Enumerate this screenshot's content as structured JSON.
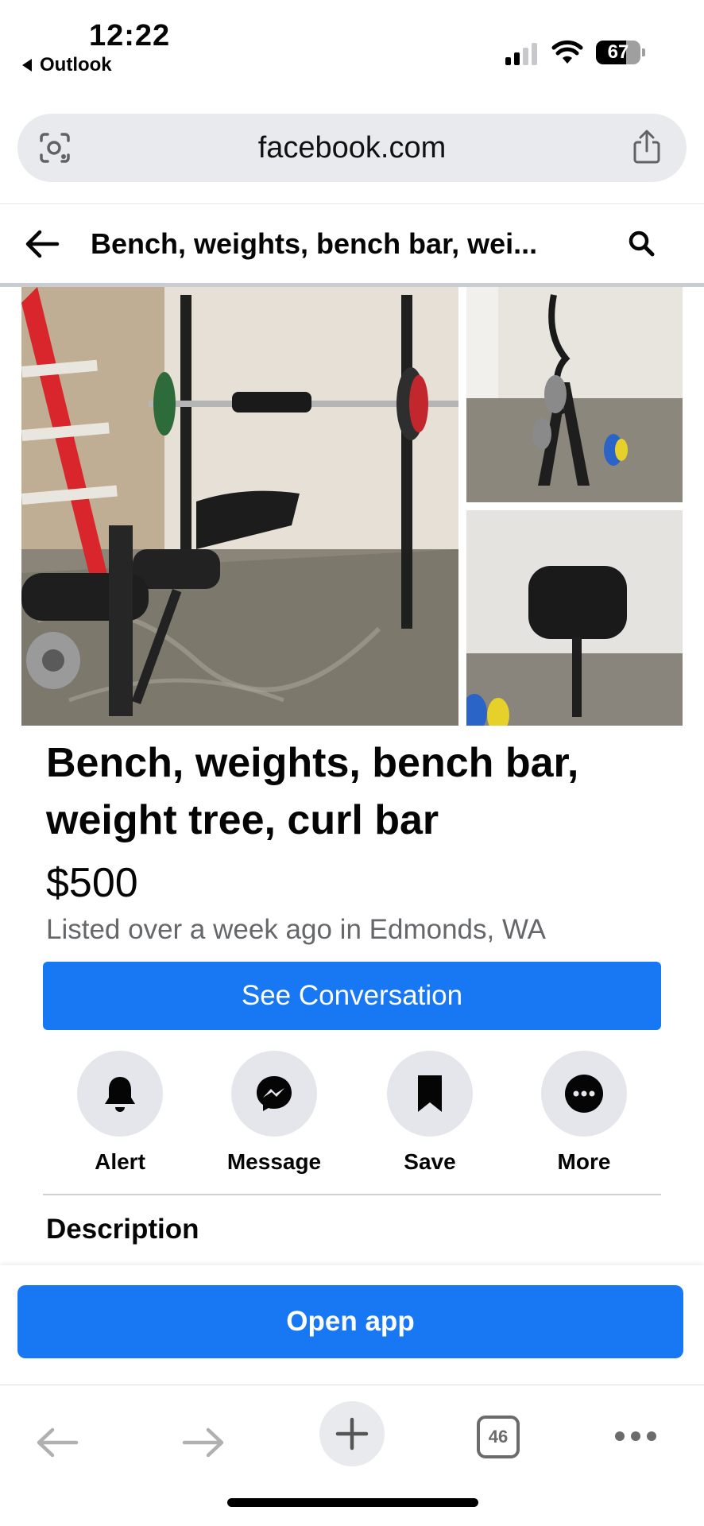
{
  "status_bar": {
    "time": "12:22",
    "back_app": "Outlook",
    "battery": "67",
    "battery_level": 0.67
  },
  "browser": {
    "url": "facebook.com"
  },
  "header": {
    "title": "Bench, weights, bench bar, wei..."
  },
  "listing": {
    "title": "Bench, weights, bench bar, weight tree, curl bar",
    "price": "$500",
    "listed": "Listed over a week ago in Edmonds, WA",
    "primary_button": "See Conversation"
  },
  "actions": [
    {
      "label": "Alert",
      "icon": "bell-icon"
    },
    {
      "label": "Message",
      "icon": "messenger-icon"
    },
    {
      "label": "Save",
      "icon": "bookmark-icon"
    },
    {
      "label": "More",
      "icon": "more-icon"
    }
  ],
  "description_heading": "Description",
  "open_app_button": "Open app",
  "toolbar": {
    "tab_count": "46"
  },
  "colors": {
    "accent": "#1877f2",
    "secondary_text": "#65676b",
    "circle_bg": "#e4e6eb"
  }
}
